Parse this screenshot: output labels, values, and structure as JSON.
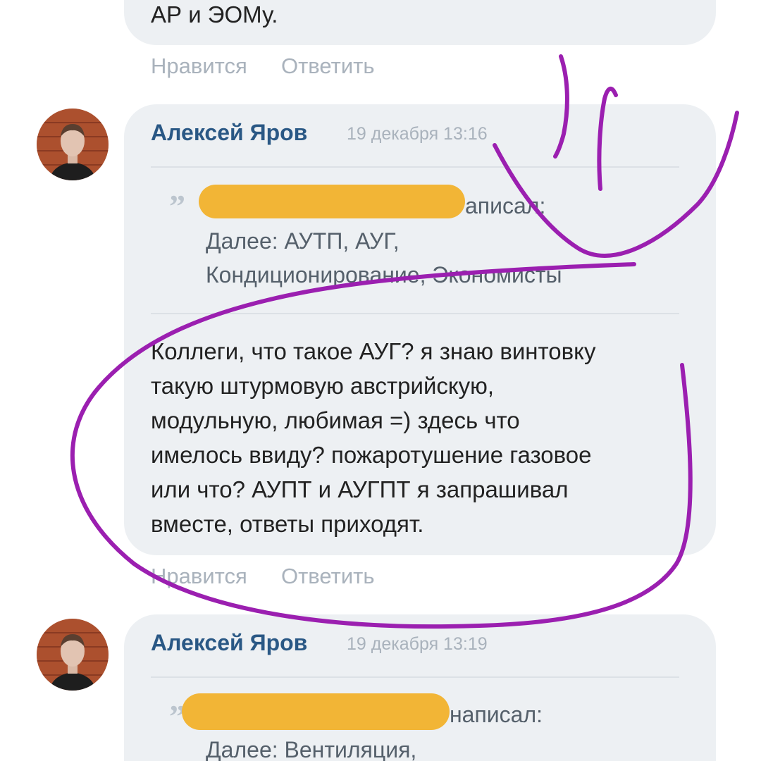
{
  "previous_comment": {
    "text_tail": "АР и ЭОМу.",
    "actions": {
      "like": "Нравится",
      "reply": "Ответить"
    }
  },
  "comments": [
    {
      "author": "Алексей Яров",
      "date": "19 декабря 13:16",
      "quote": {
        "mark": "”",
        "author_suffix": "аписал:",
        "text": "Далее: АУТП, АУГ,\nКондиционирование, Экономисты"
      },
      "text": "Коллеги, что такое АУГ? я знаю винтовку\nтакую штурмовую австрийскую,\nмодульную, любимая =) здесь что\nимелось ввиду? пожаротушение газовое\nили что? АУПТ и АУГПТ я запрашивал\nвместе, ответы приходят.",
      "actions": {
        "like": "Нравится",
        "reply": "Ответить"
      }
    },
    {
      "author": "Алексей Яров",
      "date": "19 декабря 13:19",
      "quote": {
        "mark": "”",
        "author_suffix": "написал:",
        "text": "Далее: Вентиляция,"
      }
    }
  ],
  "colors": {
    "author_link": "#2a5885",
    "muted_action": "#a9b2bc",
    "bubble_background": "#edf0f3",
    "redaction_marker": "#f2b536",
    "annotation_ink": "#9b1fb0"
  },
  "icons": {
    "quote": "quote-mark-icon",
    "avatar": "user-photo"
  }
}
